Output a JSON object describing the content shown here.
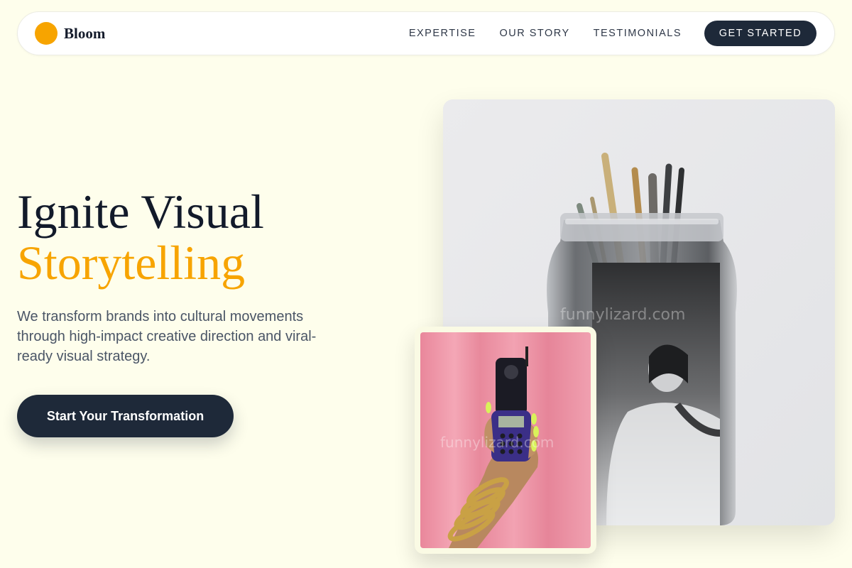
{
  "brand": {
    "name": "Bloom",
    "accent": "#f7a400",
    "dark": "#1e2939"
  },
  "nav": {
    "links": [
      "EXPERTISE",
      "OUR STORY",
      "TESTIMONIALS"
    ],
    "cta": "GET STARTED"
  },
  "hero": {
    "title_line1": "Ignite Visual",
    "title_line2": "Storytelling",
    "subtitle": "We transform brands into cultural movements through high-impact creative direction and viral-ready visual strategy.",
    "cta": "Start Your Transformation"
  },
  "images": {
    "large": {
      "subject": "glass jar with paintbrushes and vintage photo",
      "watermark": "funnylizard.com"
    },
    "small": {
      "subject": "hand holding flip phone on pink background",
      "watermark": "funnylizard.com"
    }
  }
}
